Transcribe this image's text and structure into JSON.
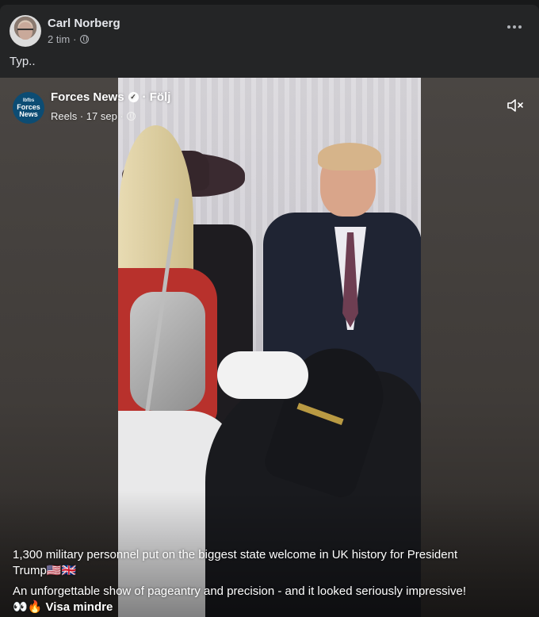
{
  "post": {
    "author": "Carl Norberg",
    "time": "2 tim",
    "separator": "·",
    "text": "Typ..",
    "more_icon": "more-horizontal-icon",
    "privacy_icon": "globe-icon"
  },
  "reel": {
    "page_name": "Forces News",
    "follow_label": "· Följ",
    "logo_top": "Ibfbs",
    "logo_line1": "Forces",
    "logo_line2": "News",
    "meta": "Reels · 17 sep ·",
    "mute_icon": "volume-muted-icon",
    "caption_line1": "1,300 military personnel put on the biggest state welcome in UK history for President Trump🇺🇸🇬🇧",
    "caption_line2": "An unforgettable show of pageantry and precision - and it looked seriously impressive!",
    "emoji": "👀🔥",
    "see_less": "Visa mindre"
  }
}
